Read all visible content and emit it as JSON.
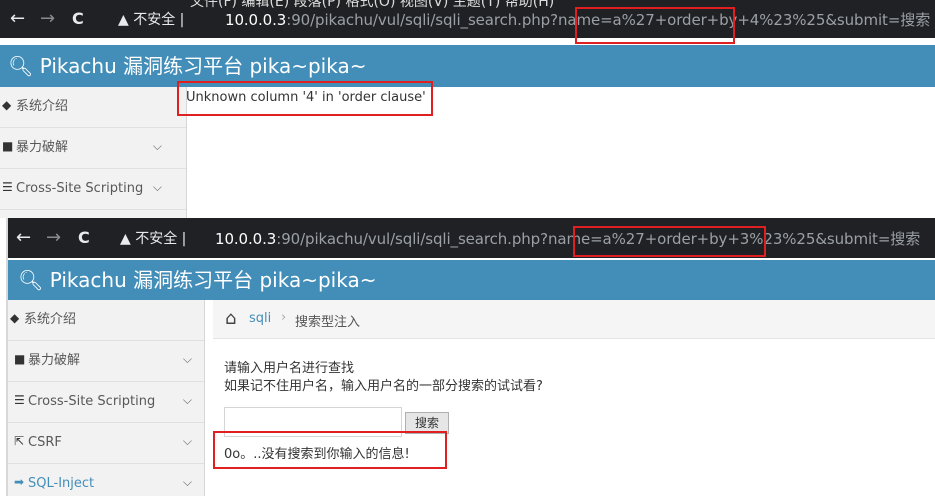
{
  "top": {
    "menu_strip": "文件(F)  编辑(E)  段落(P)  格式(O)  视图(V)  主题(T)  帮助(H)",
    "browser": {
      "back_glyph": "←",
      "forward_glyph": "→",
      "reload_glyph": "C",
      "security_label": "▲ 不安全 |",
      "url_host": "10.0.0.3",
      "url_rest": ":90/pikachu/vul/sqli/sqli_search.php?name=a%27+order+by+4%23%25&submit=搜索"
    },
    "app_title": "Pikachu 漏洞练习平台 pika~pika~",
    "sidebar": [
      {
        "icon": "tag-icon",
        "label": "系统介绍",
        "chevron": ""
      },
      {
        "icon": "lock-icon",
        "label": "暴力破解",
        "chevron": "⌵"
      },
      {
        "icon": "list-icon",
        "label": "Cross-Site Scripting",
        "chevron": "⌵"
      }
    ],
    "error_message": "Unknown column '4' in 'order clause'"
  },
  "bottom": {
    "browser": {
      "back_glyph": "←",
      "forward_glyph": "→",
      "reload_glyph": "C",
      "security_label": "▲ 不安全 |",
      "url_host": "10.0.0.3",
      "url_rest": ":90/pikachu/vul/sqli/sqli_search.php?name=a%27+order+by+3%23%25&submit=搜索"
    },
    "app_title": "Pikachu 漏洞练习平台 pika~pika~",
    "sidebar": [
      {
        "icon": "tag-icon",
        "label": "系统介绍",
        "chevron": ""
      },
      {
        "icon": "lock-icon",
        "label": "暴力破解",
        "chevron": "⌵"
      },
      {
        "icon": "list-icon",
        "label": "Cross-Site Scripting",
        "chevron": "⌵"
      },
      {
        "icon": "share-icon",
        "label": "CSRF",
        "chevron": "⌵"
      },
      {
        "icon": "arrow-icon",
        "label": "SQL-Inject",
        "chevron": "⌵"
      }
    ],
    "breadcrumb": {
      "home_glyph": "⌂",
      "link": "sqli",
      "separator": "›",
      "current": "搜索型注入"
    },
    "form": {
      "hint1": "请输入用户名进行查找",
      "hint2": "如果记不住用户名，输入用户名的一部分搜索的试试看?",
      "input_value": "",
      "submit_label": "搜索"
    },
    "result_message": "0o。..没有搜索到你输入的信息!"
  },
  "colors": {
    "browser_bar": "#202124",
    "app_bar": "#438eb9",
    "highlight_box": "#e02020"
  }
}
